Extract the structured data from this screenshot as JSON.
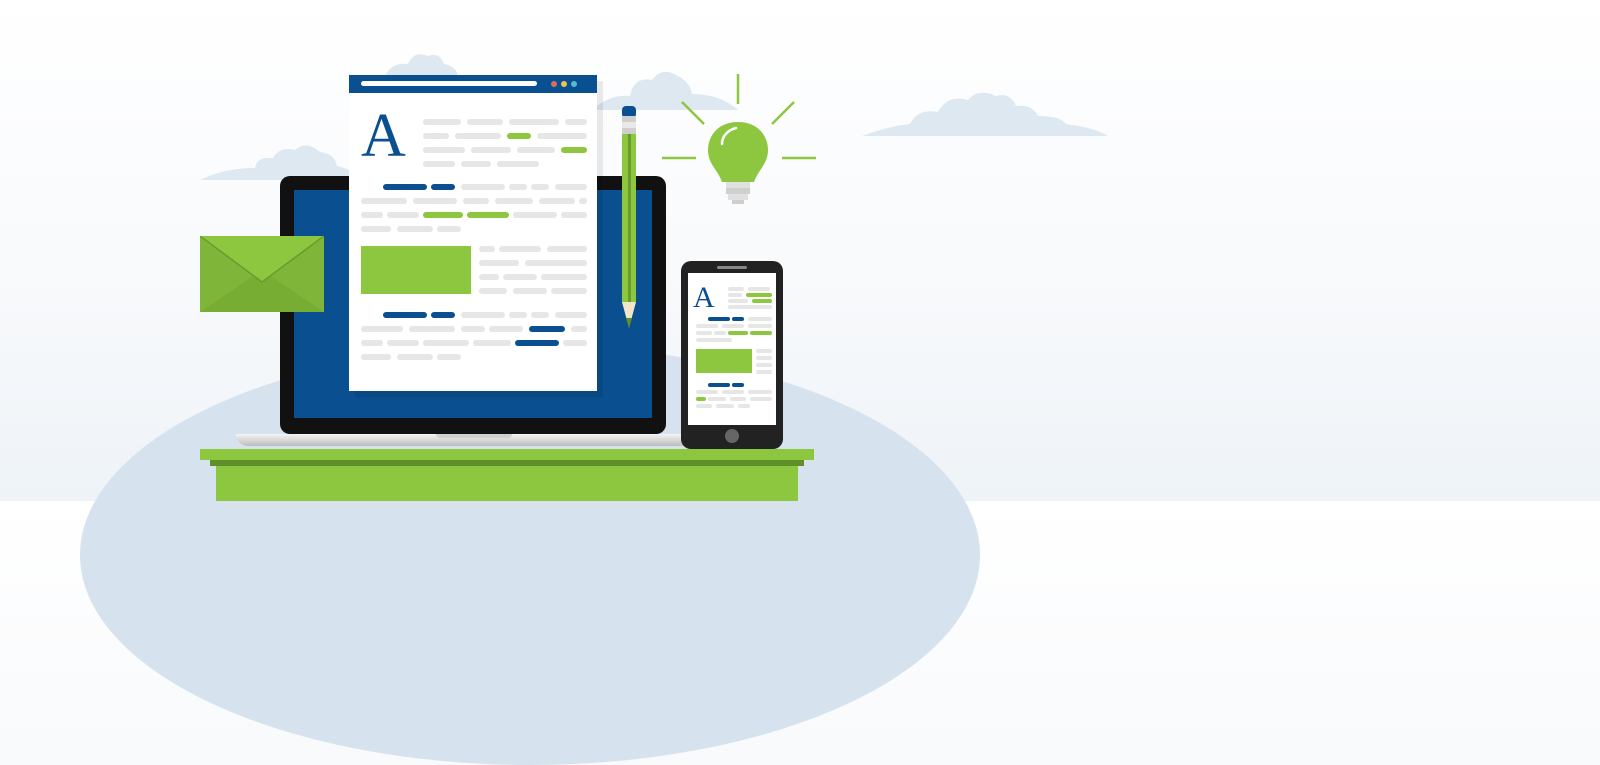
{
  "scene": {
    "colors": {
      "brand_blue": "#0a4f8f",
      "accent_green": "#8dc63f",
      "dark_green": "#6a9b2f",
      "cloud": "#dde8f1",
      "hill": "#d6e3ee",
      "laptop_frame": "#111111",
      "device_dark": "#222222",
      "placeholder_gray": "#e6e6e6"
    },
    "document": {
      "logo_letter": "A"
    },
    "phone": {
      "logo_letter": "A"
    },
    "icons": [
      "envelope-icon",
      "lightbulb-icon",
      "pencil-icon",
      "laptop-icon",
      "smartphone-icon",
      "cloud-icon",
      "desk-icon",
      "browser-window-icon"
    ]
  }
}
